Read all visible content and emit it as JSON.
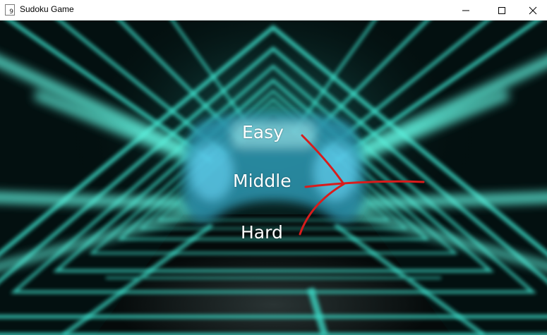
{
  "window": {
    "title": "Sudoku Game",
    "icon_glyph": "9"
  },
  "menu": {
    "items": [
      {
        "label": "Easy"
      },
      {
        "label": "Middle"
      },
      {
        "label": "Hard"
      }
    ]
  },
  "icons": [
    "app-icon",
    "minimize-icon",
    "maximize-icon",
    "close-icon",
    "gamepad-icon"
  ],
  "colors": {
    "neon": "#3de0cc",
    "annotation": "#d81c1c",
    "text": "#ffffff"
  }
}
